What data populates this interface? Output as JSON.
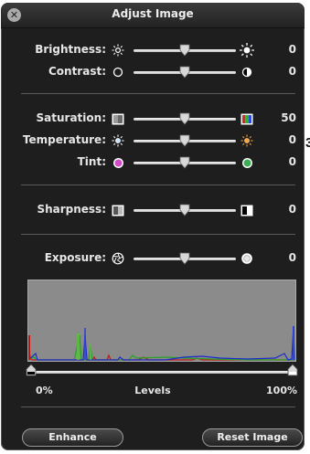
{
  "window": {
    "title": "Adjust Image"
  },
  "edge_char": "3",
  "controls": [
    {
      "id": "brightness",
      "label": "Brightness:",
      "left_icon": "sun-small-icon",
      "right_icon": "sun-large-icon",
      "value": "0",
      "level": 0.5
    },
    {
      "id": "contrast",
      "label": "Contrast:",
      "left_icon": "circle-outline-icon",
      "right_icon": "half-circle-icon",
      "value": "0",
      "level": 0.5
    },
    {
      "id": "saturation",
      "label": "Saturation:",
      "left_icon": "grayscale-square-icon",
      "right_icon": "color-square-icon",
      "value": "50",
      "level": 0.5
    },
    {
      "id": "temperature",
      "label": "Temperature:",
      "left_icon": "sun-cool-icon",
      "right_icon": "sun-warm-icon",
      "value": "0",
      "level": 0.5
    },
    {
      "id": "tint",
      "label": "Tint:",
      "left_icon": "magenta-dot-icon",
      "right_icon": "green-dot-icon",
      "value": "0",
      "level": 0.5
    },
    {
      "id": "sharpness",
      "label": "Sharpness:",
      "left_icon": "soft-square-icon",
      "right_icon": "sharp-square-icon",
      "value": "0",
      "level": 0.5
    },
    {
      "id": "exposure",
      "label": "Exposure:",
      "left_icon": "aperture-icon",
      "right_icon": "bright-dot-icon",
      "value": "0",
      "level": 0.5
    }
  ],
  "levels": {
    "label": "Levels",
    "min_label": "0%",
    "max_label": "100%",
    "black_point": 0.0,
    "white_point": 1.0
  },
  "buttons": {
    "enhance": "Enhance",
    "reset": "Reset Image"
  },
  "colors": {
    "panel": "#1e1e1e",
    "histogram_bg": "#8b8b8b",
    "red": "#c01818",
    "green": "#2aa02a",
    "blue": "#1a2ccc"
  }
}
